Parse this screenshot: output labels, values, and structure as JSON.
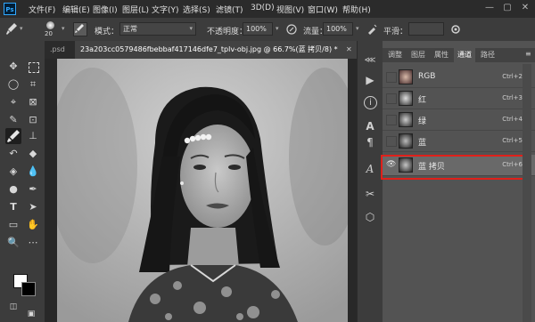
{
  "app": {
    "logo": "Ps"
  },
  "menu": [
    "文件(F)",
    "编辑(E)",
    "图像(I)",
    "图层(L)",
    "文字(Y)",
    "选择(S)",
    "滤镜(T)",
    "3D(D)",
    "视图(V)",
    "窗口(W)",
    "帮助(H)"
  ],
  "window_buttons": {
    "minimize": "—",
    "restore": "▢",
    "close": "✕"
  },
  "options": {
    "brush_size": "20",
    "mode_label": "模式：",
    "mode_value": "正常",
    "opacity_label": "不透明度：",
    "opacity_value": "100%",
    "flow_label": "流量：",
    "flow_value": "100%",
    "smoothing_label": "平滑："
  },
  "tabs": {
    "previous": ".psd",
    "active": "23a203cc0579486fbebbaf417146dfe7_tplv-obj.jpg @ 66.7%(蓝 拷贝/8) *",
    "close": "✕"
  },
  "panel": {
    "tabs": [
      "调整",
      "图层",
      "属性",
      "通道",
      "路径"
    ],
    "active_tab": "通道",
    "channels": [
      {
        "name": "RGB",
        "shortcut": "Ctrl+2",
        "visible": false
      },
      {
        "name": "红",
        "shortcut": "Ctrl+3",
        "visible": false
      },
      {
        "name": "绿",
        "shortcut": "Ctrl+4",
        "visible": false
      },
      {
        "name": "蓝",
        "shortcut": "Ctrl+5",
        "visible": false
      },
      {
        "name": "蓝 拷贝",
        "shortcut": "Ctrl+6",
        "visible": true
      }
    ],
    "eye_glyph": "👁"
  },
  "colors": {
    "highlight": "#e0201a",
    "accent": "#31a8ff",
    "active_tab_bg": "#535353"
  }
}
